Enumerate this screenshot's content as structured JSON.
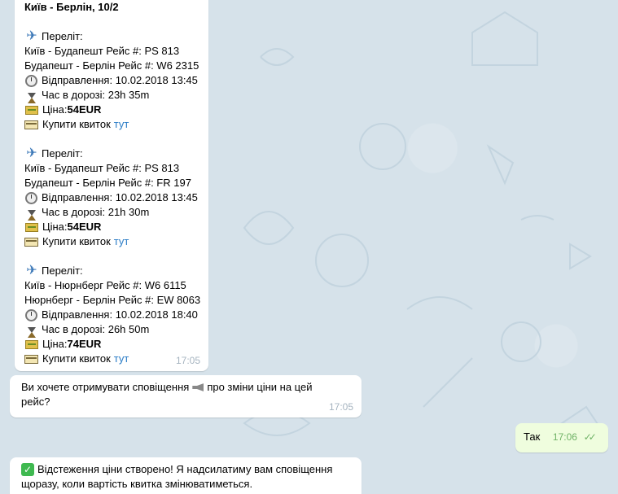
{
  "header": {
    "title": "Київ - Берлін, 10/2"
  },
  "flights": [
    {
      "label": "Переліт:",
      "leg1": "Київ - Будапешт Рейс #: PS 813",
      "leg2": "Будапешт - Берлін Рейс #: W6 2315",
      "departure": "Відправлення: 10.02.2018 13:45",
      "duration": "Час в дорозі: 23h 35m",
      "price_label": "Ціна: ",
      "price_value": "54EUR",
      "buy_label": "Купити квиток",
      "buy_link": "тут"
    },
    {
      "label": "Переліт:",
      "leg1": "Київ - Будапешт Рейс #: PS 813",
      "leg2": "Будапешт - Берлін Рейс #: FR 197",
      "departure": "Відправлення: 10.02.2018 13:45",
      "duration": "Час в дорозі: 21h 30m",
      "price_label": "Ціна: ",
      "price_value": "54EUR",
      "buy_label": "Купити квиток",
      "buy_link": "тут"
    },
    {
      "label": "Переліт:",
      "leg1": "Київ - Нюрнберг Рейс #: W6 6115",
      "leg2": "Нюрнберг - Берлін Рейс #: EW 8063",
      "departure": "Відправлення: 10.02.2018 18:40",
      "duration": "Час в дорозі: 26h 50m",
      "price_label": "Ціна: ",
      "price_value": "74EUR",
      "buy_label": "Купити квиток",
      "buy_link": "тут"
    }
  ],
  "messages": {
    "flights_time": "17:05",
    "notify_question_part1": "Ви хочете отримувати сповіщення",
    "notify_question_part2": "про зміни ціни на цей",
    "notify_question_part3": "рейс?",
    "notify_time": "17:05",
    "reply_text": "Так",
    "reply_time": "17:06",
    "confirm_line1": "Відстеження ціни створено! Я надсилатиму вам сповіщення",
    "confirm_line2": "щоразу, коли вартість квитка змінюватиметься."
  },
  "icons": {
    "flight": "airplane-icon",
    "departure": "clock-icon",
    "duration": "hourglass-icon",
    "price": "money-icon",
    "buy": "ticket-icon",
    "notify": "speaker-icon",
    "confirm": "checkmark-icon",
    "read": "double-check-icon"
  },
  "colors": {
    "background": "#d6e2ea",
    "incoming_bubble": "#ffffff",
    "outgoing_bubble": "#effdde",
    "link": "#2a7cc6",
    "time": "#a6b4c0",
    "outgoing_time": "#6fb266"
  }
}
